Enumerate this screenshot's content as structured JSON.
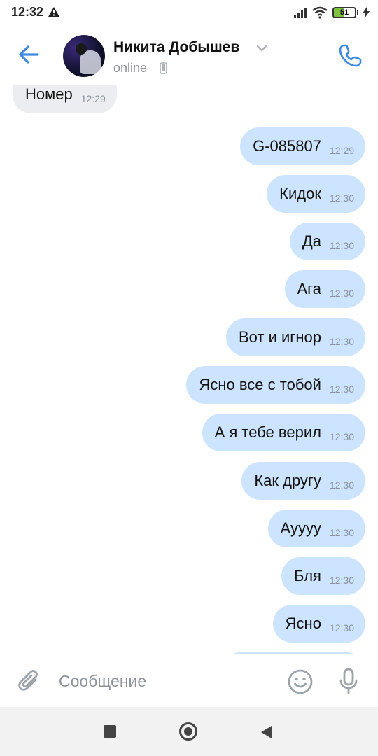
{
  "status_bar": {
    "time": "12:32",
    "battery": "51",
    "battery_level": 0.51,
    "icons": [
      "warning-icon",
      "signal-icon",
      "wifi-icon",
      "battery-icon",
      "charging-icon"
    ]
  },
  "header": {
    "contact_name": "Никита Добышев",
    "status": "online",
    "icons": [
      "back-arrow-icon",
      "chevron-down-icon",
      "mobile-phone-icon",
      "call-icon"
    ]
  },
  "messages": [
    {
      "text": "Номер",
      "time": "12:29",
      "direction": "in"
    },
    {
      "text": "G-085807",
      "time": "12:29",
      "direction": "out"
    },
    {
      "text": "Кидок",
      "time": "12:30",
      "direction": "out"
    },
    {
      "text": "Да",
      "time": "12:30",
      "direction": "out"
    },
    {
      "text": "Ага",
      "time": "12:30",
      "direction": "out"
    },
    {
      "text": "Вот и игнор",
      "time": "12:30",
      "direction": "out"
    },
    {
      "text": "Ясно все с тобой",
      "time": "12:30",
      "direction": "out"
    },
    {
      "text": "А я тебе верил",
      "time": "12:30",
      "direction": "out"
    },
    {
      "text": "Как другу",
      "time": "12:30",
      "direction": "out"
    },
    {
      "text": "Ауууу",
      "time": "12:30",
      "direction": "out"
    },
    {
      "text": "Бля",
      "time": "12:30",
      "direction": "out"
    },
    {
      "text": "Ясно",
      "time": "12:30",
      "direction": "out"
    }
  ],
  "composer": {
    "placeholder": "Сообщение",
    "icons": [
      "paperclip-icon",
      "emoji-icon",
      "microphone-icon"
    ]
  },
  "colors": {
    "accent": "#3f8ae0",
    "outgoing_bubble": "#cce4ff",
    "incoming_bubble": "#ebedf0"
  }
}
